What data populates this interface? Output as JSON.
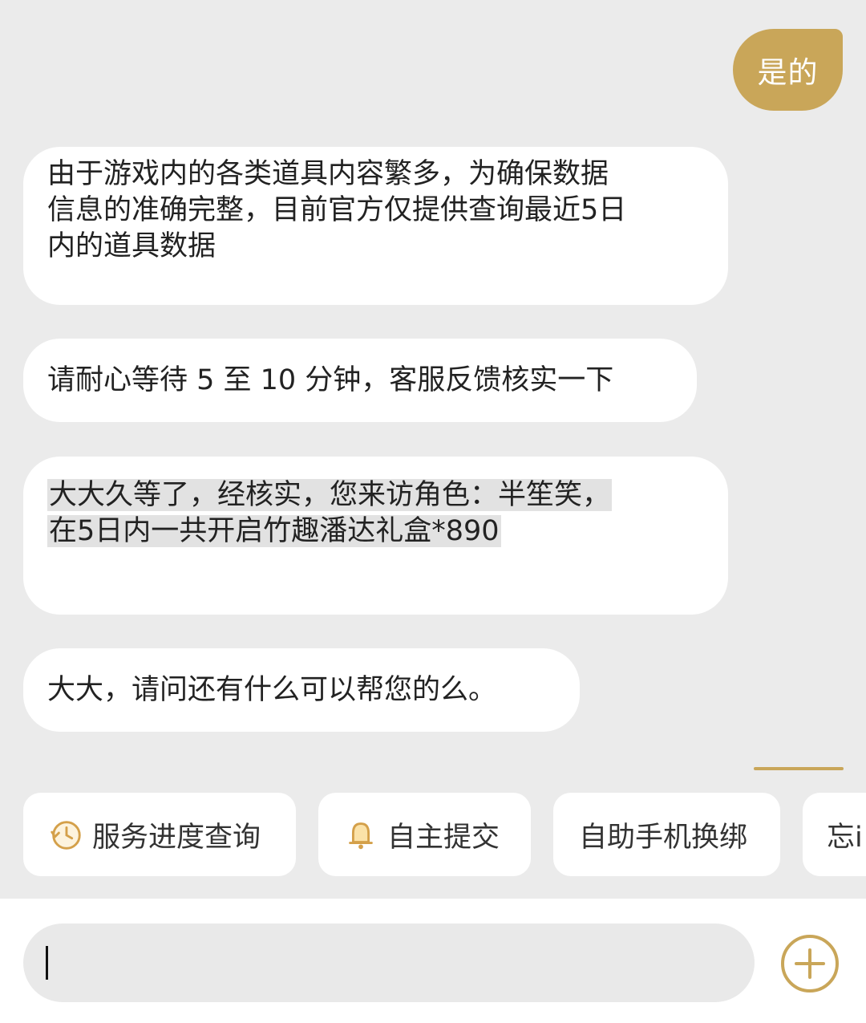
{
  "messages": {
    "user_reply": "是的",
    "agent_1": {
      "lines": [
        "由于游戏内的各类道具内容繁多，为确保数据",
        "信息的准确完整，目前官方仅提供查询最近5日",
        "内的道具数据"
      ]
    },
    "agent_2": "请耐心等待 5 至 10 分钟，客服反馈核实一下",
    "agent_3": {
      "lines": [
        "大大久等了，经核实，您来访角色：半笙笑，",
        "在5日内一共开启竹趣潘达礼盒*890"
      ]
    },
    "agent_4": "大大，请问还有什么可以帮您的么。"
  },
  "quick_actions": [
    {
      "label": "服务进度查询",
      "icon": "clock-progress-icon"
    },
    {
      "label": "自主提交",
      "icon": "bell-icon"
    },
    {
      "label": "自助手机换绑",
      "icon": ""
    },
    {
      "label": "忘i",
      "icon": ""
    }
  ],
  "input": {
    "placeholder": "",
    "value": ""
  },
  "colors": {
    "accent": "#c9a659",
    "background": "#ebebeb",
    "bubble": "#ffffff"
  }
}
